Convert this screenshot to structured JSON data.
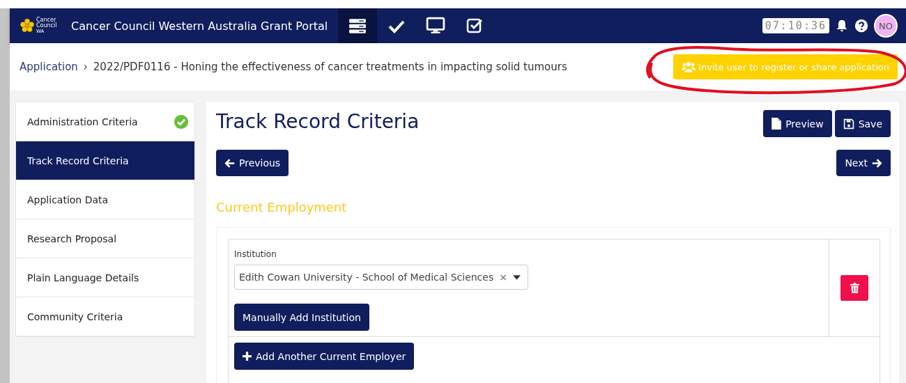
{
  "header": {
    "logo_lines": [
      "Cancer",
      "Council",
      "WA"
    ],
    "title": "Cancer Council Western Australia Grant Portal",
    "nav": [
      {
        "kind": "list",
        "selected": true
      },
      {
        "kind": "check",
        "selected": false
      },
      {
        "kind": "monitor",
        "selected": false
      },
      {
        "kind": "checkbox",
        "selected": false
      }
    ],
    "clock": "07:10:36",
    "avatar": "NO"
  },
  "breadcrumb": {
    "link": "Application",
    "separator": "›",
    "current": "2022/PDF0116 - Honing the effectiveness of cancer treatments in impacting solid tumours"
  },
  "invite_button": "Invite user to register or share application",
  "sidebar": [
    {
      "label": "Administration Criteria",
      "selected": false,
      "complete": true
    },
    {
      "label": "Track Record Criteria",
      "selected": true,
      "complete": false
    },
    {
      "label": "Application Data",
      "selected": false,
      "complete": false
    },
    {
      "label": "Research Proposal",
      "selected": false,
      "complete": false
    },
    {
      "label": "Plain Language Details",
      "selected": false,
      "complete": false
    },
    {
      "label": "Community Criteria",
      "selected": false,
      "complete": false
    }
  ],
  "page": {
    "title": "Track Record Criteria",
    "preview": "Preview",
    "save": "Save",
    "previous": "Previous",
    "next": "Next",
    "section": "Current Employment",
    "institution_label": "Institution",
    "institution_value": "Edith Cowan University - School of Medical Sciences",
    "clear": "×",
    "manual_add": "Manually Add Institution",
    "add_employer": "Add Another Current Employer"
  }
}
